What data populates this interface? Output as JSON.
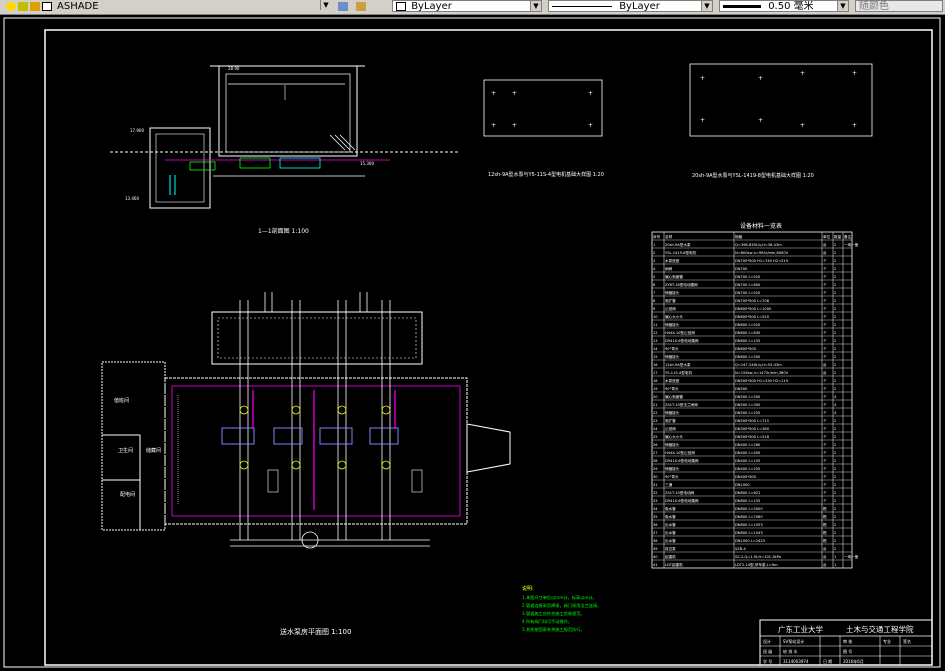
{
  "toolbar": {
    "layer_name": "ASHADE",
    "color_combo": "ByLayer",
    "linetype_combo": "ByLayer",
    "lineweight_combo": "0.50 毫米",
    "plotstyle_combo": "随颜色"
  },
  "drawing": {
    "section_title": "1—1剖面图 1:100",
    "plan_title": "送水泵房平面图 1:100",
    "anchor_left_title": "12sh-9A型水泵与Y5-11S-4型电机基础大样图 1:20",
    "anchor_right_title": "20sh-9A型水泵与YSL-1419-8型电机基础大样图 1:20",
    "rooms": {
      "duty_room": "值班间",
      "toilet": "卫生间",
      "storage": "储藏间",
      "power_room": "配电间"
    },
    "notes_title": "说明:",
    "notes": [
      "1.本图尺寸单位以mm计，标高以m计。",
      "2.管道连接采用焊接，阀门采用法兰连接。",
      "3.管道施工应符合施工验收规范。",
      "4.所有阀门均可手动操作。",
      "5.其他按国家有关施工规范执行。"
    ],
    "table_title": "设备材料一览表",
    "table_headers": [
      "序号",
      "名称",
      "规格",
      "单位",
      "数量",
      "备注"
    ],
    "table_rows": [
      [
        "1",
        "20sh-9A型水泵",
        "Q=396-630L/s,H=38-43m",
        "台",
        "2",
        "一用一备"
      ],
      [
        "2",
        "YSL-1419-8型电机",
        "N=800kw,n=985r/min,6000V",
        "台",
        "2",
        ""
      ],
      [
        "3",
        "水泵底座",
        "DN700*500 H1=740 H2=519",
        "个",
        "2",
        ""
      ],
      [
        "4",
        "闸阀",
        "DN700",
        "个",
        "2",
        ""
      ],
      [
        "5",
        "偏心渐缩管",
        "DN700 L=520",
        "个",
        "2",
        ""
      ],
      [
        "6",
        "ZY6T-16型电动蝶阀",
        "DN700 L=600",
        "个",
        "2",
        ""
      ],
      [
        "7",
        "伸缩接头",
        "DN700 L=520",
        "个",
        "2",
        ""
      ],
      [
        "8",
        "渐扩管",
        "DN700*500 L=706",
        "个",
        "2",
        ""
      ],
      [
        "9",
        "止回阀",
        "DN600*500 L=1000",
        "个",
        "2",
        ""
      ],
      [
        "10",
        "偏心大小头",
        "DN600*500 L=520",
        "个",
        "2",
        ""
      ],
      [
        "11",
        "伸缩接头",
        "DN600 L=520",
        "个",
        "2",
        ""
      ],
      [
        "12",
        "H44X-10型止回阀",
        "DN600 L=830",
        "个",
        "2",
        ""
      ],
      [
        "13",
        "D941X-6型电动蝶阀",
        "DN600 L=155",
        "个",
        "2",
        ""
      ],
      [
        "14",
        "90°弯头",
        "DN600*500",
        "个",
        "2",
        ""
      ],
      [
        "15",
        "伸缩接头",
        "DN600 L=500",
        "个",
        "2",
        ""
      ],
      [
        "16",
        "12sh-9A型水泵",
        "Q=147-246L/s,H=55-43m",
        "台",
        "2",
        ""
      ],
      [
        "17",
        "Y5-11S-4型电机",
        "N=155kw,n=1475r/min,380V",
        "台",
        "2",
        ""
      ],
      [
        "18",
        "水泵底座",
        "DN500*300 H1=530 H2=119",
        "个",
        "2",
        ""
      ],
      [
        "19",
        "90°弯头",
        "DN500",
        "个",
        "2",
        ""
      ],
      [
        "20",
        "偏心渐缩管",
        "DN500 L=500",
        "个",
        "4",
        ""
      ],
      [
        "21",
        "Z41T-10型法兰闸阀",
        "DN500 L=300",
        "个",
        "4",
        ""
      ],
      [
        "22",
        "伸缩接头",
        "DN500 L=255",
        "个",
        "4",
        ""
      ],
      [
        "23",
        "渐扩管",
        "DN500*300 L=715",
        "个",
        "2",
        ""
      ],
      [
        "24",
        "止回阀",
        "DN300*500 L=360",
        "个",
        "2",
        ""
      ],
      [
        "25",
        "偏心大小头",
        "DN500*300 L=518",
        "个",
        "2",
        ""
      ],
      [
        "26",
        "伸缩接头",
        "DN400 L=260",
        "个",
        "2",
        ""
      ],
      [
        "27",
        "H44X-10型止回阀",
        "DN400 L=400",
        "个",
        "2",
        ""
      ],
      [
        "28",
        "D941X-6型电动蝶阀",
        "DN400 L=105",
        "个",
        "2",
        ""
      ],
      [
        "29",
        "伸缩接头",
        "DN400 L=255",
        "个",
        "2",
        ""
      ],
      [
        "30",
        "90°弯头",
        "DN400*300",
        "个",
        "2",
        ""
      ],
      [
        "31",
        "三通",
        "DN1000",
        "个",
        "2",
        ""
      ],
      [
        "32",
        "Z41T-10型电动阀",
        "DN800 L=621",
        "个",
        "2",
        ""
      ],
      [
        "33",
        "D941X-6型电动蝶阀",
        "DN800 L=155",
        "个",
        "2",
        ""
      ],
      [
        "34",
        "吸水管",
        "DN800 L=5000",
        "根",
        "2",
        ""
      ],
      [
        "35",
        "吸水管",
        "DN800 L=7080",
        "根",
        "2",
        ""
      ],
      [
        "36",
        "出水管",
        "DN800 L=1053",
        "根",
        "2",
        ""
      ],
      [
        "37",
        "出水管",
        "DN800 L=1043",
        "根",
        "2",
        ""
      ],
      [
        "38",
        "出水管",
        "DN1000 L=2423",
        "根",
        "2",
        ""
      ],
      [
        "39",
        "真空泵",
        "SZB-4",
        "台",
        "2",
        ""
      ],
      [
        "40",
        "起重机",
        "SZ-2,Q=1.5t,H=101.3kPa",
        "台",
        "1",
        "一用一备"
      ],
      [
        "41",
        "LDT起重机",
        "LDT2-14型,吊车梁,L=9m",
        "台",
        "1",
        ""
      ]
    ],
    "title_block": {
      "school": "广东工业大学",
      "college": "土木与交通工程学院",
      "cells": [
        "设计",
        "SV泵站设计",
        "审 核",
        "班 级",
        "给 排 水",
        "图 号",
        "学 号",
        "3114003974",
        "日 期",
        "2016年6月",
        "专业",
        "签名"
      ]
    }
  }
}
